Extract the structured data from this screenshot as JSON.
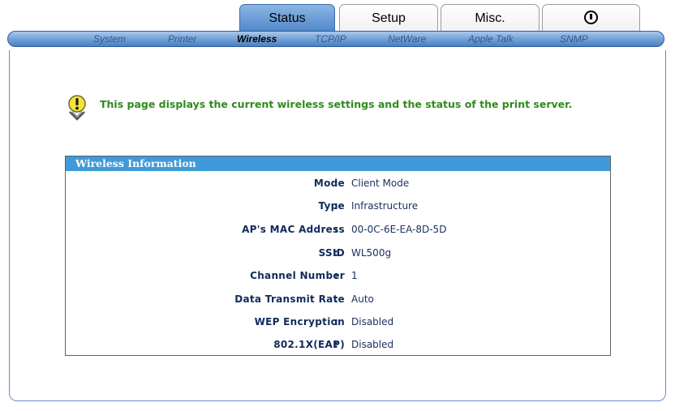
{
  "main_tabs": [
    {
      "label": "Status",
      "active": true
    },
    {
      "label": "Setup",
      "active": false
    },
    {
      "label": "Misc.",
      "active": false
    },
    {
      "label": "",
      "icon": "power-info-icon",
      "active": false
    }
  ],
  "sub_nav": [
    {
      "label": "System",
      "active": false
    },
    {
      "label": "Printer",
      "active": false
    },
    {
      "label": "Wireless",
      "active": true
    },
    {
      "label": "TCP/IP",
      "active": false
    },
    {
      "label": "NetWare",
      "active": false
    },
    {
      "label": "Apple Talk",
      "active": false
    },
    {
      "label": "SNMP",
      "active": false
    }
  ],
  "notice": {
    "icon": "lightbulb-hint-icon",
    "text": "This page displays the current wireless settings and the status of the print server."
  },
  "wireless_info": {
    "title": "Wireless Information",
    "rows": [
      {
        "label": "Mode",
        "value": "Client Mode"
      },
      {
        "label": "Type",
        "value": "Infrastructure"
      },
      {
        "label": "AP's MAC Address",
        "value": "00-0C-6E-EA-8D-5D"
      },
      {
        "label": "SSID",
        "value": "WL500g"
      },
      {
        "label": "Channel Number",
        "value": "1"
      },
      {
        "label": "Data Transmit Rate",
        "value": "Auto"
      },
      {
        "label": "WEP Encryption",
        "value": "Disabled"
      },
      {
        "label": "802.1X(EAP)",
        "value": "Disabled"
      }
    ]
  },
  "colors": {
    "accent_blue": "#3f9ad9",
    "notice_green": "#2f8a1e",
    "label_navy": "#102a5a"
  }
}
